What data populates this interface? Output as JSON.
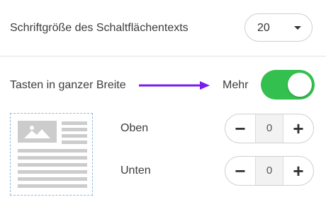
{
  "font_size": {
    "label": "Schriftgröße des Schaltflächentexts",
    "value": "20",
    "icon": "chevron-down-icon"
  },
  "full_width": {
    "label": "Tasten in ganzer Breite",
    "toggle_label": "Mehr",
    "enabled": true,
    "toggle_color": "#33c04e",
    "arrow_color": "#7a1cf0"
  },
  "spacing": {
    "top_label": "Oben",
    "top_value": "0",
    "bottom_label": "Unten",
    "bottom_value": "0",
    "minus_symbol": "−",
    "plus_symbol": "+"
  }
}
